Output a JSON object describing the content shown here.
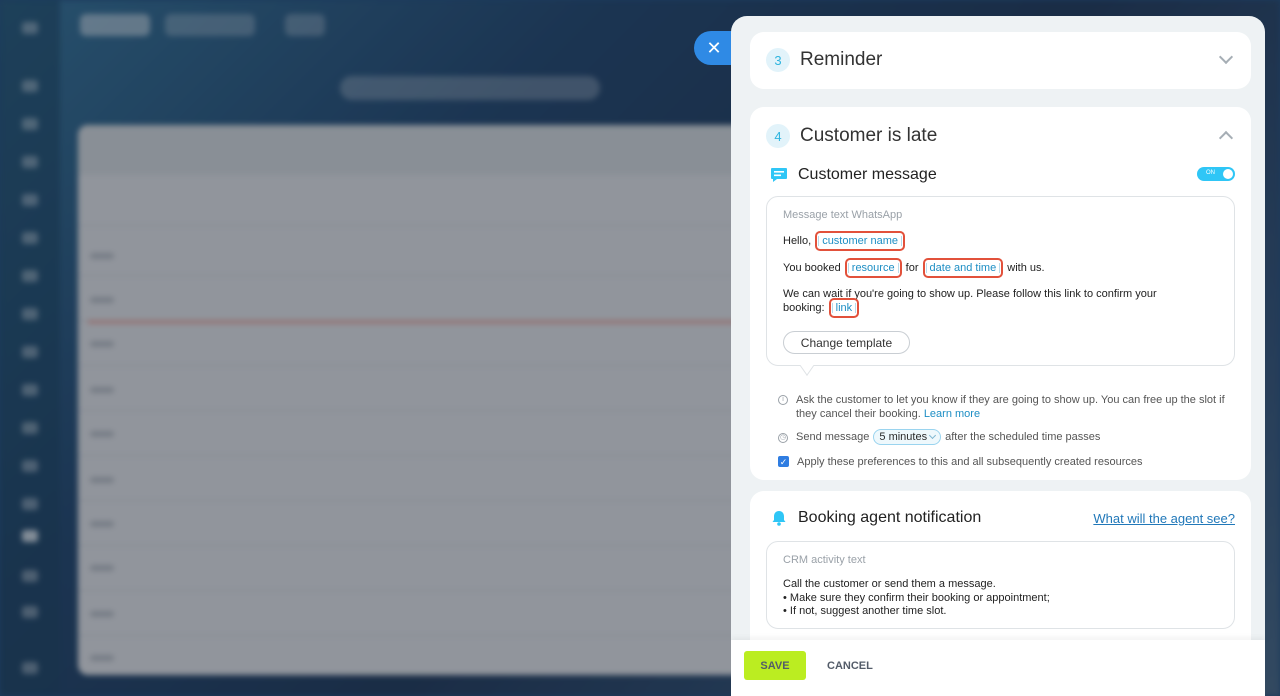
{
  "panel": {
    "reminder": {
      "step": "3",
      "title": "Reminder"
    },
    "customer_late": {
      "step": "4",
      "title": "Customer is late",
      "customer_message": {
        "title": "Customer message",
        "toggle_label": "ON",
        "box_label": "Message text WhatsApp",
        "line1_prefix": "Hello,",
        "tag_customer_name": "customer name",
        "line2_prefix": "You booked",
        "tag_resource": "resource",
        "line2_mid": "for",
        "tag_date_time": "date and time",
        "line2_suffix": "with us.",
        "line3": "We can wait if you're going to show up. Please follow this link to confirm your",
        "line4_prefix": "booking:",
        "tag_link": "link",
        "change_template": "Change template"
      },
      "hint_text": "Ask the customer to let you know if they are going to show up. You can free up the slot if they cancel their booking.",
      "learn_more": "Learn more",
      "send_prefix": "Send message",
      "send_value": "5 minutes",
      "send_suffix": "after the scheduled time passes",
      "apply_label": "Apply these preferences to this and all subsequently created resources"
    },
    "agent_notification": {
      "title": "Booking agent notification",
      "link": "What will the agent see?",
      "box_label": "CRM activity text",
      "line1": "Call the customer or send them a message.",
      "line2": "• Make sure they confirm their booking or appointment;",
      "line3": "• If not, suggest another time slot."
    }
  },
  "footer": {
    "save": "SAVE",
    "cancel": "CANCEL"
  },
  "colors": {
    "accent": "#2fc6f6",
    "save_bg": "#bbed21",
    "link": "#2178b9",
    "highlight": "#e2513b"
  }
}
